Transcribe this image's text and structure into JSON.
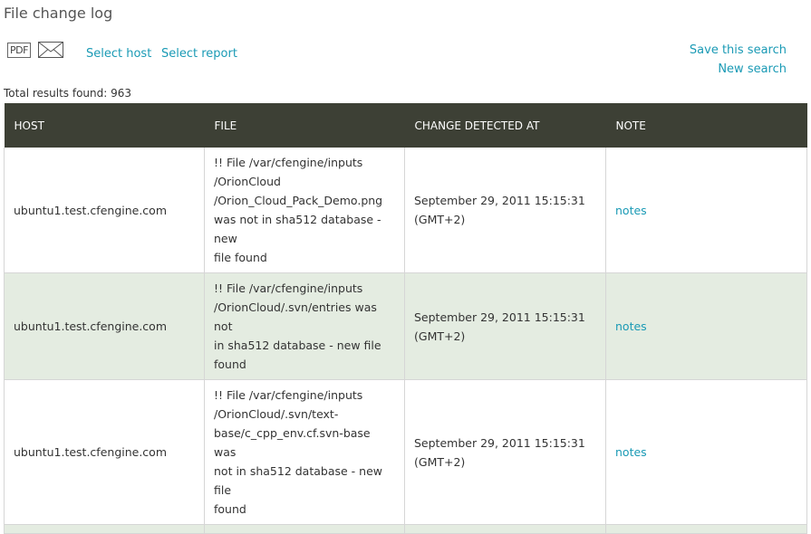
{
  "page": {
    "title": "File change log"
  },
  "toolbar": {
    "pdf_label": "PDF",
    "select_host": "Select host",
    "select_report": "Select report",
    "save_search": "Save this search",
    "new_search": "New search"
  },
  "summary": {
    "total_results": "Total results found: 963"
  },
  "table": {
    "columns": [
      "HOST",
      "FILE",
      "CHANGE DETECTED AT",
      "NOTE"
    ],
    "rows": [
      {
        "host": "ubuntu1.test.cfengine.com",
        "file": [
          "!! File /var/cfengine/inputs",
          "/OrionCloud",
          "/Orion_Cloud_Pack_Demo.png",
          "was not in sha512 database - new",
          "file found"
        ],
        "detected": [
          "September 29, 2011 15:15:31",
          "(GMT+2)"
        ],
        "note": "notes"
      },
      {
        "host": "ubuntu1.test.cfengine.com",
        "file": [
          "!! File /var/cfengine/inputs",
          "/OrionCloud/.svn/entries was not",
          "in sha512 database - new file",
          "found"
        ],
        "detected": [
          "September 29, 2011 15:15:31",
          "(GMT+2)"
        ],
        "note": "notes"
      },
      {
        "host": "ubuntu1.test.cfengine.com",
        "file": [
          "!! File /var/cfengine/inputs",
          "/OrionCloud/.svn/text-",
          "base/c_cpp_env.cf.svn-base was",
          "not in sha512 database - new file",
          "found"
        ],
        "detected": [
          "September 29, 2011 15:15:31",
          "(GMT+2)"
        ],
        "note": "notes"
      }
    ]
  },
  "colors": {
    "header_bg": "#3d4035",
    "link": "#1a9ab5",
    "alt_row": "#e4ece1"
  }
}
